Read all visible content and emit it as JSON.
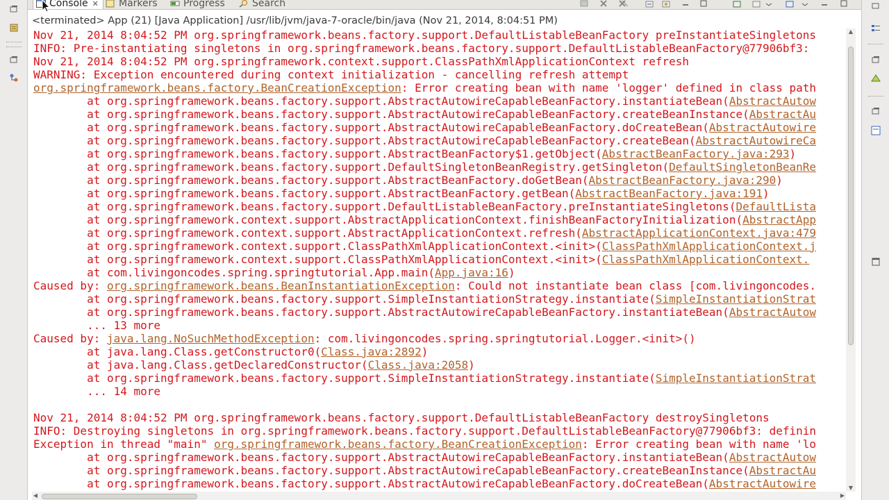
{
  "tabs": [
    {
      "label": "Console",
      "icon": "console-icon"
    },
    {
      "label": "Markers",
      "icon": "markers-icon"
    },
    {
      "label": "Progress",
      "icon": "progress-icon"
    },
    {
      "label": "Search",
      "icon": "search-icon"
    }
  ],
  "tab_close_glyph": "✕",
  "description": "<terminated> App (21) [Java Application] /usr/lib/jvm/java-7-oracle/bin/java (Nov 21, 2014, 8:04:51 PM)",
  "colors": {
    "error_text": "#d3171c",
    "link_text": "#b0632b",
    "background": "#ffffff",
    "trim": "#ecebea"
  },
  "console_lines": [
    {
      "text": "Nov 21, 2014 8:04:52 PM org.springframework.beans.factory.support.DefaultListableBeanFactory preInstantiateSingletons"
    },
    {
      "text": "INFO: Pre-instantiating singletons in org.springframework.beans.factory.support.DefaultListableBeanFactory@77906bf3:"
    },
    {
      "text": "Nov 21, 2014 8:04:52 PM org.springframework.context.support.ClassPathXmlApplicationContext refresh"
    },
    {
      "text": "WARNING: Exception encountered during context initialization - cancelling refresh attempt"
    },
    {
      "pre": "",
      "link": "org.springframework.beans.factory.BeanCreationException",
      "post": ": Error creating bean with name 'logger' defined in class path"
    },
    {
      "pre": "        at org.springframework.beans.factory.support.AbstractAutowireCapableBeanFactory.instantiateBean(",
      "link": "AbstractAutow",
      "post": ""
    },
    {
      "pre": "        at org.springframework.beans.factory.support.AbstractAutowireCapableBeanFactory.createBeanInstance(",
      "link": "AbstractAu",
      "post": ""
    },
    {
      "pre": "        at org.springframework.beans.factory.support.AbstractAutowireCapableBeanFactory.doCreateBean(",
      "link": "AbstractAutowire",
      "post": ""
    },
    {
      "pre": "        at org.springframework.beans.factory.support.AbstractAutowireCapableBeanFactory.createBean(",
      "link": "AbstractAutowireCa",
      "post": ""
    },
    {
      "pre": "        at org.springframework.beans.factory.support.AbstractBeanFactory$1.getObject(",
      "link": "AbstractBeanFactory.java:293",
      "post": ")"
    },
    {
      "pre": "        at org.springframework.beans.factory.support.DefaultSingletonBeanRegistry.getSingleton(",
      "link": "DefaultSingletonBeanRe",
      "post": ""
    },
    {
      "pre": "        at org.springframework.beans.factory.support.AbstractBeanFactory.doGetBean(",
      "link": "AbstractBeanFactory.java:290",
      "post": ")"
    },
    {
      "pre": "        at org.springframework.beans.factory.support.AbstractBeanFactory.getBean(",
      "link": "AbstractBeanFactory.java:191",
      "post": ")"
    },
    {
      "pre": "        at org.springframework.beans.factory.support.DefaultListableBeanFactory.preInstantiateSingletons(",
      "link": "DefaultLista",
      "post": ""
    },
    {
      "pre": "        at org.springframework.context.support.AbstractApplicationContext.finishBeanFactoryInitialization(",
      "link": "AbstractApp",
      "post": ""
    },
    {
      "pre": "        at org.springframework.context.support.AbstractApplicationContext.refresh(",
      "link": "AbstractApplicationContext.java:479",
      "post": ""
    },
    {
      "pre": "        at org.springframework.context.support.ClassPathXmlApplicationContext.<init>(",
      "link": "ClassPathXmlApplicationContext.j",
      "post": ""
    },
    {
      "pre": "        at org.springframework.context.support.ClassPathXmlApplicationContext.<init>(",
      "link": "ClassPathXmlApplicationContext.",
      "post": ""
    },
    {
      "pre": "        at com.livingoncodes.spring.springtutorial.App.main(",
      "link": "App.java:16",
      "post": ")"
    },
    {
      "pre": "Caused by: ",
      "link": "org.springframework.beans.BeanInstantiationException",
      "post": ": Could not instantiate bean class [com.livingoncodes."
    },
    {
      "pre": "        at org.springframework.beans.factory.support.SimpleInstantiationStrategy.instantiate(",
      "link": "SimpleInstantiationStrat",
      "post": ""
    },
    {
      "pre": "        at org.springframework.beans.factory.support.AbstractAutowireCapableBeanFactory.instantiateBean(",
      "link": "AbstractAutow",
      "post": ""
    },
    {
      "text": "        ... 13 more"
    },
    {
      "pre": "Caused by: ",
      "link": "java.lang.NoSuchMethodException",
      "post": ": com.livingoncodes.spring.springtutorial.Logger.<init>()"
    },
    {
      "pre": "        at java.lang.Class.getConstructor0(",
      "link": "Class.java:2892",
      "post": ")"
    },
    {
      "pre": "        at java.lang.Class.getDeclaredConstructor(",
      "link": "Class.java:2058",
      "post": ")"
    },
    {
      "pre": "        at org.springframework.beans.factory.support.SimpleInstantiationStrategy.instantiate(",
      "link": "SimpleInstantiationStrat",
      "post": ""
    },
    {
      "text": "        ... 14 more"
    },
    {
      "text": ""
    },
    {
      "text": "Nov 21, 2014 8:04:52 PM org.springframework.beans.factory.support.DefaultListableBeanFactory destroySingletons"
    },
    {
      "text": "INFO: Destroying singletons in org.springframework.beans.factory.support.DefaultListableBeanFactory@77906bf3: definin"
    },
    {
      "pre": "Exception in thread \"main\" ",
      "link": "org.springframework.beans.factory.BeanCreationException",
      "post": ": Error creating bean with name 'lo"
    },
    {
      "pre": "        at org.springframework.beans.factory.support.AbstractAutowireCapableBeanFactory.instantiateBean(",
      "link": "AbstractAutow",
      "post": ""
    },
    {
      "pre": "        at org.springframework.beans.factory.support.AbstractAutowireCapableBeanFactory.createBeanInstance(",
      "link": "AbstractAu",
      "post": ""
    },
    {
      "pre": "        at org.springframework.beans.factory.support.AbstractAutowireCapableBeanFactory.doCreateBean(",
      "link": "AbstractAutowire",
      "post": ""
    }
  ]
}
